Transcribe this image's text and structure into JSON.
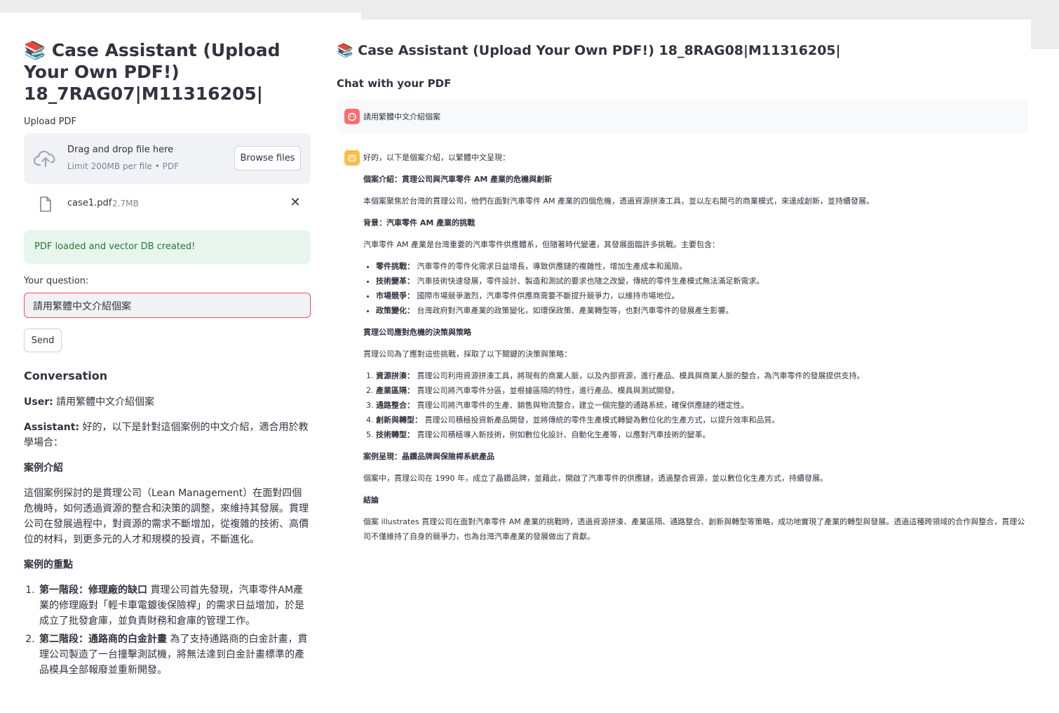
{
  "left": {
    "title": "📚 Case Assistant (Upload Your Own PDF!) 18_7RAG07|M11316205|",
    "upload_label": "Upload PDF",
    "dropzone": {
      "text": "Drag and drop file here",
      "limit": "Limit 200MB per file • PDF",
      "browse_label": "Browse files"
    },
    "file": {
      "name": "case1.pdf",
      "size": "2.7MB",
      "icon": "file-icon",
      "remove_icon": "close-icon"
    },
    "success_message": "PDF loaded and vector DB created!",
    "question_label": "Your question:",
    "question_value": "請用繁體中文介紹個案",
    "send_label": "Send",
    "conversation": {
      "title": "Conversation",
      "user_prefix": "User:",
      "user_text": "請用繁體中文介紹個案",
      "assistant_prefix": "Assistant:",
      "assistant_intro": "好的，以下是針對這個案例的中文介紹，適合用於教學場合：",
      "h1": "案例介紹",
      "p1": "這個案例探討的是貫理公司（Lean Management）在面對四個危機時，如何透過資源的整合和決策的調整，來維持其發展。貫理公司在發展過程中，對資源的需求不斷增加，從複雜的技術、高價位的材料，到更多元的人才和規模的投資，不斷進化。",
      "h2": "案例的重點",
      "items": [
        {
          "bold": "第一階段：修理廠的缺口",
          "text": " 貫理公司首先發現，汽車零件AM產業的修理廠對「輕卡車電鍍後保險桿」的需求日益增加，於是成立了批發倉庫，並負責財務和倉庫的管理工作。"
        },
        {
          "bold": "第二階段：通路商的白金計畫",
          "text": " 為了支持通路商的白金計畫，貫理公司製造了一台撞擊測試機，將無法達到白金計畫標準的產品模具全部報廢並重新開發。"
        }
      ]
    }
  },
  "right": {
    "title": "📚 Case Assistant (Upload Your Own PDF!) 18_8RAG08|M11316205|",
    "chat_subtitle": "Chat with your PDF",
    "user_message": "請用繁體中文介紹個案",
    "user_avatar_icon": "user-avatar-icon",
    "bot_avatar_icon": "bot-avatar-icon",
    "bot": {
      "intro": "好的，以下是個案介紹，以繁體中文呈現：",
      "h_case": "個案介紹：貫理公司與汽車零件 AM 產業的危機與創新",
      "p_case": "本個案聚焦於台灣的貫理公司，他們在面對汽車零件 AM 產業的四個危機，透過資源拼湊工具，並以左右開弓的商業模式，來達成創新，並持續發展。",
      "h_bg": "背景：汽車零件 AM 產業的挑戰",
      "p_bg": "汽車零件 AM 產業是台灣重要的汽車零件供應體系，但隨著時代變遷，其發展面臨許多挑戰。主要包含：",
      "bullets": [
        {
          "bold": "零件挑戰：",
          "text": " 汽車零件的零件化需求日益增長，導致供應鏈的複雜性，增加生產成本和風險。"
        },
        {
          "bold": "技術變革：",
          "text": " 汽車技術快速發展，零件設計、製造和測試的要求也隨之改變，傳統的零件生產模式無法滿足新需求。"
        },
        {
          "bold": "市場競爭：",
          "text": " 國際市場競爭激烈，汽車零件供應商需要不斷提升競爭力，以維持市場地位。"
        },
        {
          "bold": "政策變化：",
          "text": " 台灣政府對汽車產業的政策變化，如環保政策、產業轉型等，也對汽車零件的發展產生影響。"
        }
      ],
      "h_strategy": "貫理公司應對危機的決策與策略",
      "p_strategy": "貫理公司為了應對這些挑戰，採取了以下關鍵的決策與策略：",
      "numbered": [
        {
          "bold": "資源拼湊：",
          "text": " 貫理公司利用資源拼湊工具，將現有的商業人脈，以及內部資源，進行產品、模具與商業人脈的整合，為汽車零件的發展提供支持。"
        },
        {
          "bold": "產業區隔：",
          "text": " 貫理公司將汽車零件分區，並根據區隔的特性，進行產品、模具與測試開發。"
        },
        {
          "bold": "通路整合：",
          "text": " 貫理公司將汽車零件的生產、銷售與物流整合，建立一個完整的通路系統，確保供應鏈的穩定性。"
        },
        {
          "bold": "創新與轉型：",
          "text": " 貫理公司積極投資新產品開發，並將傳統的零件生產模式轉變為數位化的生產方式，以提升效率和品質。"
        },
        {
          "bold": "技術轉型：",
          "text": " 貫理公司積極導入新技術，例如數位化設計、自動化生產等，以應對汽車技術的變革。"
        }
      ],
      "h_present": "案例呈現：晶鑽品牌與保險桿系統產品",
      "p_present": "個案中，貫理公司在 1990 年，成立了晶鑽品牌，並藉此，開啟了汽車零件的供應鏈，透過整合資源，並以數位化生產方式，持續發展。",
      "h_conclusion": "結論",
      "p_conclusion": "個案 illustrates 貫理公司在面對汽車零件 AM 產業的挑戰時，透過資源拼湊、產業區隔、通路整合、創新與轉型等策略，成功地實現了產業的轉型與發展。透過這種跨領域的合作與整合，貫理公司不僅維持了自身的競爭力，也為台灣汽車產業的發展做出了貢獻。"
    }
  },
  "colors": {
    "error_border": "#ff4b4b",
    "success_bg": "#e8f5ec",
    "success_text": "#1f7a3d",
    "user_avatar": "#ff6c6c",
    "bot_avatar": "#ffbd45"
  }
}
